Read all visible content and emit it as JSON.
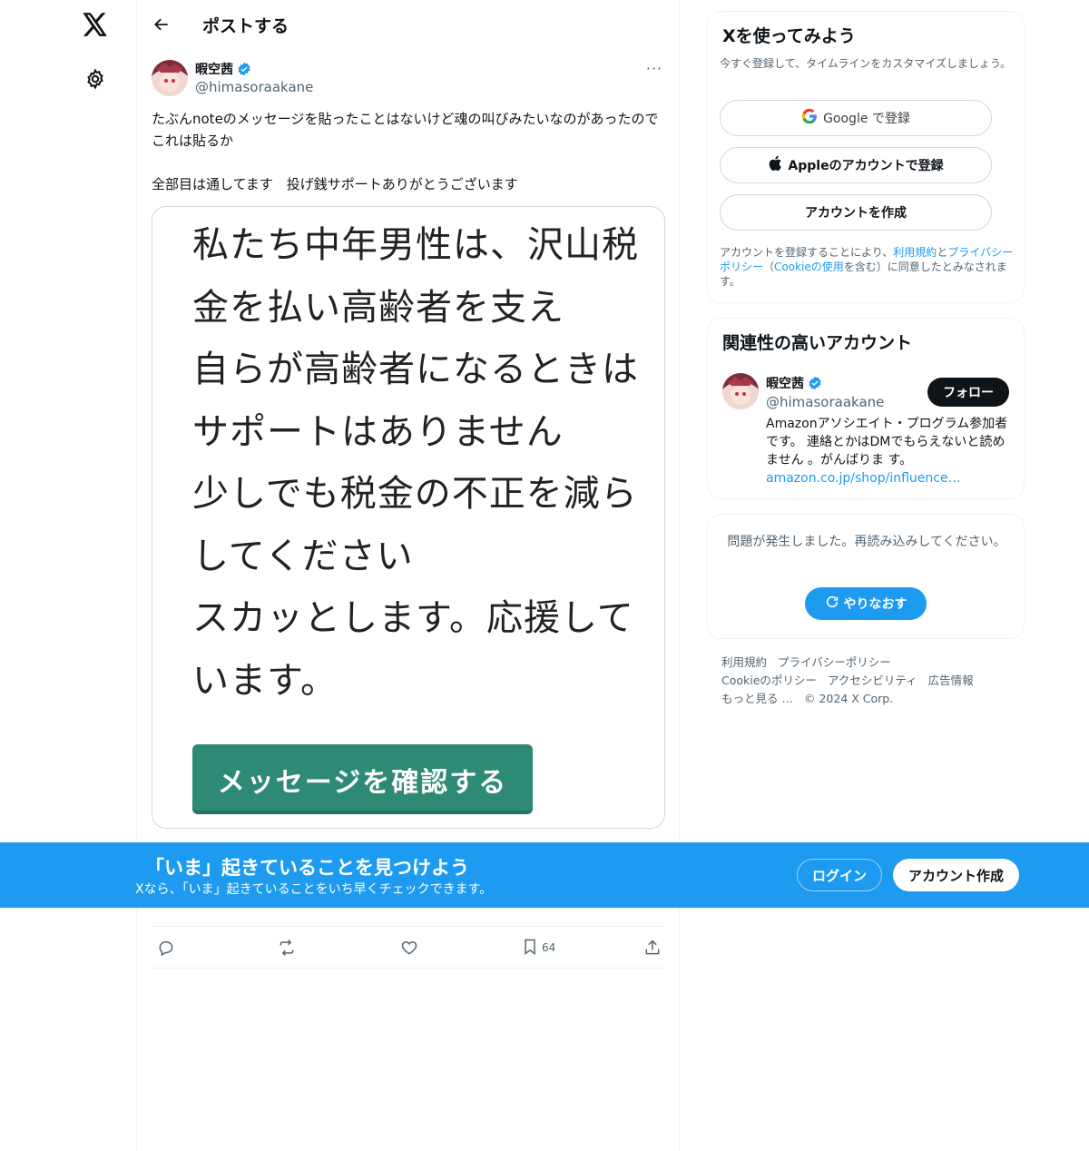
{
  "nav": {
    "logo_icon": "x-logo-icon",
    "settings_icon": "gear-icon"
  },
  "header": {
    "title": "ポストする",
    "back_icon": "arrow-left-icon"
  },
  "post": {
    "author_name": "暇空茜",
    "author_handle": "@himasoraakane",
    "verified": true,
    "more_label": "···",
    "text": "たぶんnoteのメッセージを貼ったことはないけど魂の叫びみたいなのがあったのでこれは貼るか\n\n全部目は通してます　投げ銭サポートありがとうございます",
    "image": {
      "lines": [
        "私たち中年男性は、沢山税",
        "金を払い高齢者を支え",
        "自らが高齢者になるときは",
        "サポートはありません",
        "少しでも税金の不正を減ら",
        "してください",
        "スカッとします。応援して",
        "います。"
      ],
      "button_label": "メッセージを確認する",
      "button_color": "#2d8a74"
    },
    "actions": {
      "reply_icon": "reply-icon",
      "repost_icon": "repost-icon",
      "like_icon": "heart-icon",
      "bookmark_icon": "bookmark-icon",
      "bookmark_count": "64",
      "share_icon": "share-icon"
    }
  },
  "signup": {
    "title": "Xを使ってみよう",
    "subtitle": "今すぐ登録して、タイムラインをカスタマイズしましょう。",
    "google_label": "Google で登録",
    "apple_label": "Appleのアカウントで登録",
    "create_label": "アカウントを作成",
    "terms_prefix": "アカウントを登録することにより、",
    "terms_link": "利用規約",
    "terms_and": "と",
    "privacy_link": "プライバシーポリシー",
    "terms_paren_open": "（",
    "cookie_link": "Cookieの使用",
    "terms_suffix": "を含む）に同意したとみなされます。"
  },
  "related": {
    "title": "関連性の高いアカウント",
    "name": "暇空茜",
    "handle": "@himasoraakane",
    "follow_label": "フォロー",
    "bio": "Amazonアソシエイト・プログラム参加者です。 連絡とかはDMでもらえないと読めません 。がんばりま す。",
    "bio_link": "amazon.co.jp/shop/influence…"
  },
  "error_card": {
    "message": "問題が発生しました。再読み込みしてください。",
    "retry_label": "やりなおす",
    "retry_icon": "refresh-icon"
  },
  "footer": {
    "links": [
      "利用規約",
      "プライバシーポリシー",
      "Cookieのポリシー",
      "アクセシビリティ",
      "広告情報",
      "もっと見る …",
      "© 2024 X Corp."
    ]
  },
  "banner": {
    "title": "「いま」起きていることを見つけよう",
    "subtitle": "Xなら、「いま」起きていることをいち早くチェックできます。",
    "login_label": "ログイン",
    "signup_label": "アカウント作成",
    "color": "#1d9bf0"
  }
}
